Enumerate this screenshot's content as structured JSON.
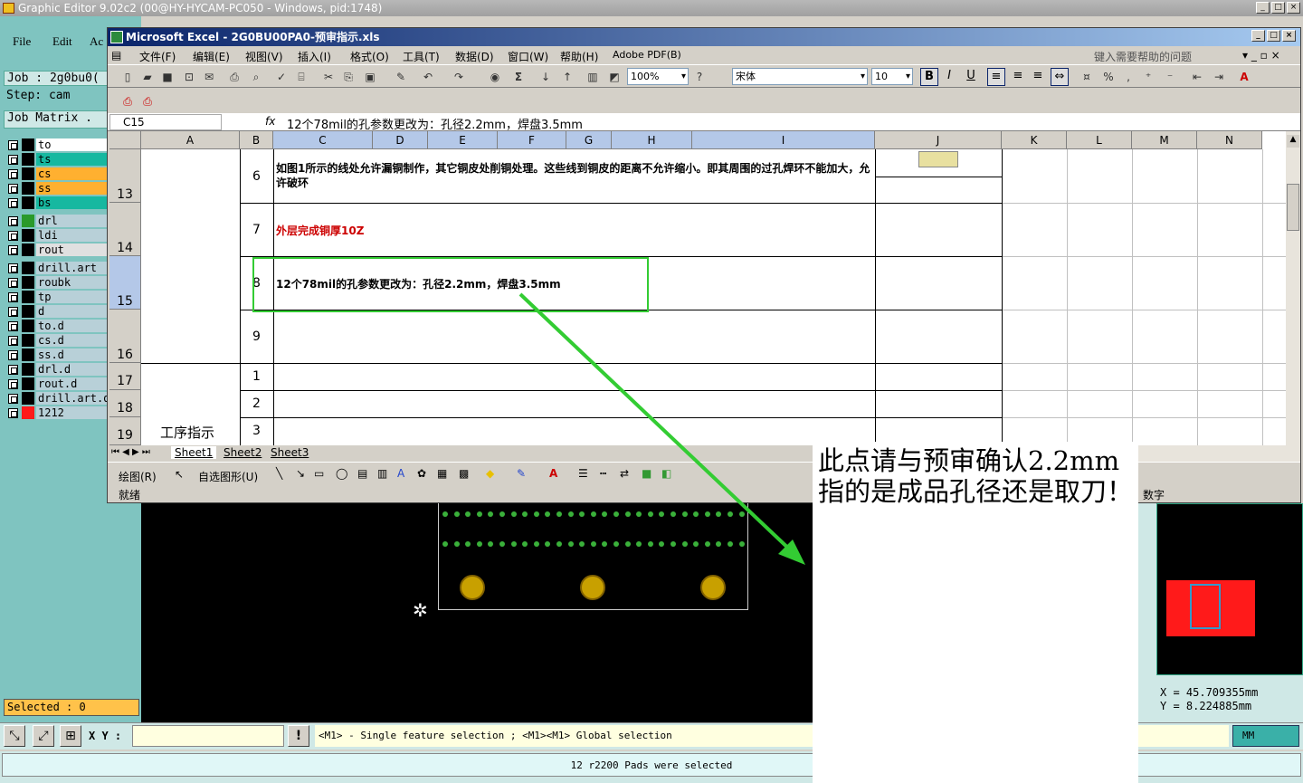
{
  "ge": {
    "title": "Graphic Editor 9.02c2 (00@HY-HYCAM-PC050 - Windows, pid:1748)",
    "menu": [
      "File",
      "Edit",
      "Ac"
    ],
    "job": "Job : 2g0bu0(",
    "step": "Step: cam",
    "job_matrix": "Job Matrix .",
    "layers": [
      {
        "name": "to",
        "color": "#ffffff"
      },
      {
        "name": "ts",
        "color": "#16b8a0"
      },
      {
        "name": "cs",
        "color": "#ffb030"
      },
      {
        "name": "ss",
        "color": "#ffb030"
      },
      {
        "name": "bs",
        "color": "#16b8a0"
      },
      {
        "name": "drl",
        "color": "#b8d0d8"
      },
      {
        "name": "ldi",
        "color": "#b8d0d8"
      },
      {
        "name": "rout",
        "color": "#e0e0e0"
      },
      {
        "name": "drill.art",
        "color": "#b8d0d8"
      },
      {
        "name": "roubk",
        "color": "#b8d0d8"
      },
      {
        "name": "tp",
        "color": "#b8d0d8"
      },
      {
        "name": "d",
        "color": "#b8d0d8"
      },
      {
        "name": "to.d",
        "color": "#b8d0d8"
      },
      {
        "name": "cs.d",
        "color": "#b8d0d8"
      },
      {
        "name": "ss.d",
        "color": "#b8d0d8"
      },
      {
        "name": "drl.d",
        "color": "#b8d0d8"
      },
      {
        "name": "rout.d",
        "color": "#b8d0d8"
      },
      {
        "name": "drill.art.d",
        "color": "#b8d0d8"
      },
      {
        "name": "1212",
        "color": "#b8d0d8"
      }
    ],
    "selected": "Selected : 0",
    "xy_label": "X Y :",
    "hint": "<M1> - Single feature selection ; <M1><M1> Global selection",
    "status": "12 r2200 Pads were selected",
    "coord_x": "X = 45.709355mm",
    "coord_y": "Y = 8.224885mm",
    "units": "MM"
  },
  "xl": {
    "title": "Microsoft Excel - 2G0BU00PA0-预审指示.xls",
    "menu": [
      "文件(F)",
      "编辑(E)",
      "视图(V)",
      "插入(I)",
      "格式(O)",
      "工具(T)",
      "数据(D)",
      "窗口(W)",
      "帮助(H)",
      "Adobe PDF(B)"
    ],
    "help_box": "键入需要帮助的问题",
    "zoom": "100%",
    "font": "宋体",
    "font_size": "10",
    "name_box": "C15",
    "fx": "fx",
    "formula": "12个78mil的孔参数更改为：孔径2.2mm，焊盘3.5mm",
    "columns": [
      "A",
      "B",
      "C",
      "D",
      "E",
      "F",
      "G",
      "H",
      "I",
      "J",
      "K",
      "L",
      "M",
      "N"
    ],
    "rows": [
      "13",
      "14",
      "15",
      "16",
      "17",
      "18",
      "19"
    ],
    "cells": {
      "b13": "6",
      "c13": "如图1所示的线处允许漏铜制作，其它铜皮处削铜处理。这些线到铜皮的距离不允许缩小。即其周围的过孔焊环不能加大，允许破环",
      "b14": "7",
      "c14": "外层完成铜厚10Z",
      "b15": "8",
      "c15": "12个78mil的孔参数更改为：孔径2.2mm，焊盘3.5mm",
      "b16": "9",
      "b17": "1",
      "b18": "2",
      "b19": "3",
      "a19": "工序指示"
    },
    "sheets": [
      "Sheet1",
      "Sheet2",
      "Sheet3"
    ],
    "draw_label": "绘图(R)",
    "autoshape_label": "自选图形(U)",
    "status": "就绪",
    "status_right": "数字",
    "colors": {
      "red_text": "#cc0000",
      "highlight_box": "#33cc33"
    }
  },
  "note": {
    "text": "此点请与预审确认2.2mm指的是成品孔径还是取刀！"
  }
}
